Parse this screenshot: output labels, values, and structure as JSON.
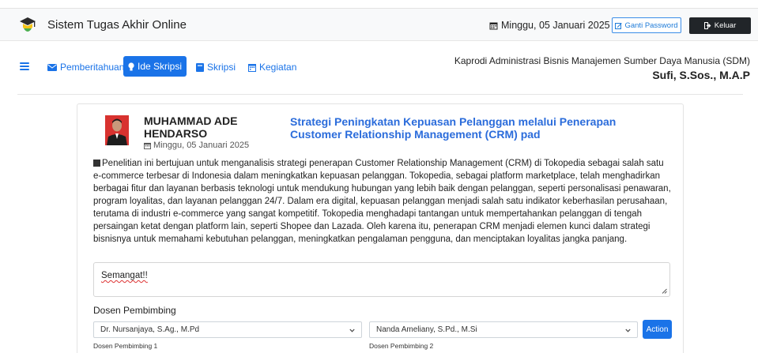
{
  "header": {
    "app_title": "Sistem Tugas Akhir Online",
    "date": "Minggu, 05 Januari 2025",
    "change_password_label": "Ganti Password",
    "logout_label": "Keluar"
  },
  "nav": {
    "items": [
      {
        "label": "Pemberitahuan",
        "icon": "envelope-icon"
      },
      {
        "label": "Ide Skripsi",
        "icon": "lightbulb-icon",
        "active": true
      },
      {
        "label": "Skripsi",
        "icon": "book-icon"
      },
      {
        "label": "Kegiatan",
        "icon": "calendar-icon"
      }
    ],
    "role": "Kaprodi Administrasi Bisnis Manajemen Sumber Daya Manusia (SDM)",
    "user_name": "Sufi, S.Sos., M.A.P"
  },
  "post": {
    "student_name": "MUHAMMAD ADE HENDARSO",
    "date": "Minggu, 05 Januari 2025",
    "title": "Strategi Peningkatan Kepuasan Pelanggan melalui Penerapan Customer Relationship Management (CRM) pad",
    "description": "Penelitian ini bertujuan untuk menganalisis strategi penerapan Customer Relationship Management (CRM) di Tokopedia sebagai salah satu e-commerce terbesar di Indonesia dalam meningkatkan kepuasan pelanggan. Tokopedia, sebagai platform marketplace, telah menghadirkan berbagai fitur dan layanan berbasis teknologi untuk mendukung hubungan yang lebih baik dengan pelanggan, seperti personalisasi penawaran, program loyalitas, dan layanan pelanggan 24/7. Dalam era digital, kepuasan pelanggan menjadi salah satu indikator keberhasilan perusahaan, terutama di industri e-commerce yang sangat kompetitif. Tokopedia menghadapi tantangan untuk mempertahankan pelanggan di tengah persaingan ketat dengan platform lain, seperti Shopee dan Lazada. Oleh karena itu, penerapan CRM menjadi elemen kunci dalam strategi bisnisnya untuk memahami kebutuhan pelanggan, meningkatkan pengalaman pengguna, dan menciptakan loyalitas jangka panjang.",
    "comment": "Semangat!!",
    "dosen_label": "Dosen Pembimbing",
    "pembimbing1_value": "Dr. Nursanjaya, S.Ag., M.Pd",
    "pembimbing2_value": "Nanda Ameliany, S.Pd., M.Si",
    "pembimbing1_caption": "Dosen Pembimbing 1",
    "pembimbing2_caption": "Dosen Pembimbing 2",
    "action_label": "Action"
  },
  "colors": {
    "primary": "#1a73e8",
    "dark": "#212529",
    "avatar_bg": "#d8322f"
  }
}
